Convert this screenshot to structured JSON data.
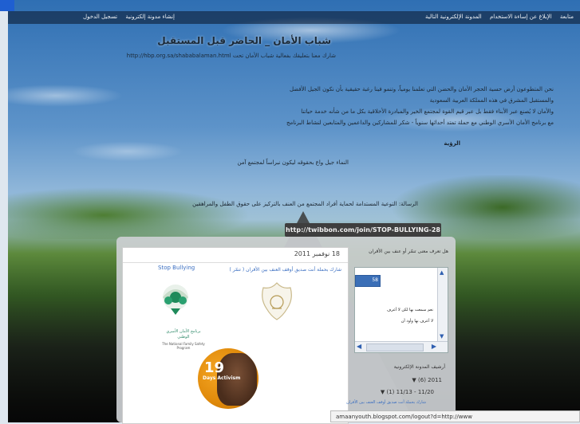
{
  "topbar": {
    "right_items": [
      "متابعة",
      "الإبلاغ عن إساءة الاستخدام",
      "المدونة الإلكترونية التالية"
    ],
    "left_items": [
      "إنشاء مدونة إلكترونية",
      "تسجيل الدخول"
    ]
  },
  "blog": {
    "title": "شباب الأمان _ الحاضر قبل المستقبل",
    "description": "شارك معنا بتعليقك بفعالية شباب الأمان تحت http://hbp.org.sa/shababalaman.html",
    "about_lines": [
      "نحن المتطوعون أرض حسية الحجر الأمان والحضن التي تعلمنا يومياً، وتنمو فينا رغبة حقيقية بأن نكون الجيل الأفضل",
      "والمستقبل المشرق في هذه المملكة العربية السعودية",
      "والأمان لا يُصنع عبر الأبناء فقط بل عبر قيم القوة لمجتمع الخير والمبادرة الأخلاقية بكل ما من شأنه خدمة حياتنا",
      "مع برنامج الأمان الأسري الوطني مع حملة تمتد أحداثها سنوياً - شكر للمشاركين والداعمين والمتابعين لنشاط البرنامج"
    ],
    "vision_label": "الرؤية",
    "vision_text": "النماء جيل واع بحقوقه ليكون نبراساً لمجتمع آمن",
    "mission_text": "الرسالة: التوعية المستدامة لحماية أفراد المجتمع من العنف بالتركيز على حقوق الطفل والمراهقين"
  },
  "link_banner": "http://twibbon.com/join/STOP-BULLYING-28",
  "post": {
    "date": "18 نوفمبر 2011",
    "title": "شارك بحملة أنت صديق أوقف العنف بين الأقران ( تنمّر )",
    "tagline": "Stop Bullying",
    "logo_caption": "برنامج الأمان الأسري الوطني",
    "logo_caption_en": "The National Family Safety Program",
    "badge_number": "19",
    "badge_label": "Days Activism"
  },
  "sidebar": {
    "poll_question": "هل تعرف معنى تنمّر أو عنف بين الأقران",
    "poll_bar_value": "58",
    "poll_options": [
      "نعم سمعت بها لكن لا أعرف",
      "لا أعرف بها وأود أن"
    ],
    "archive_title": "أرشيف المدونة الإلكترونية",
    "archive_year": "2011 (6)",
    "archive_month": "11/20 - 11/13 (1)",
    "archive_post": "شارك بحملة أنت صديق أوقف العنف بين الأقران"
  },
  "statusbar": "amaanyouth.blogspot.com/logout?d=http://www"
}
